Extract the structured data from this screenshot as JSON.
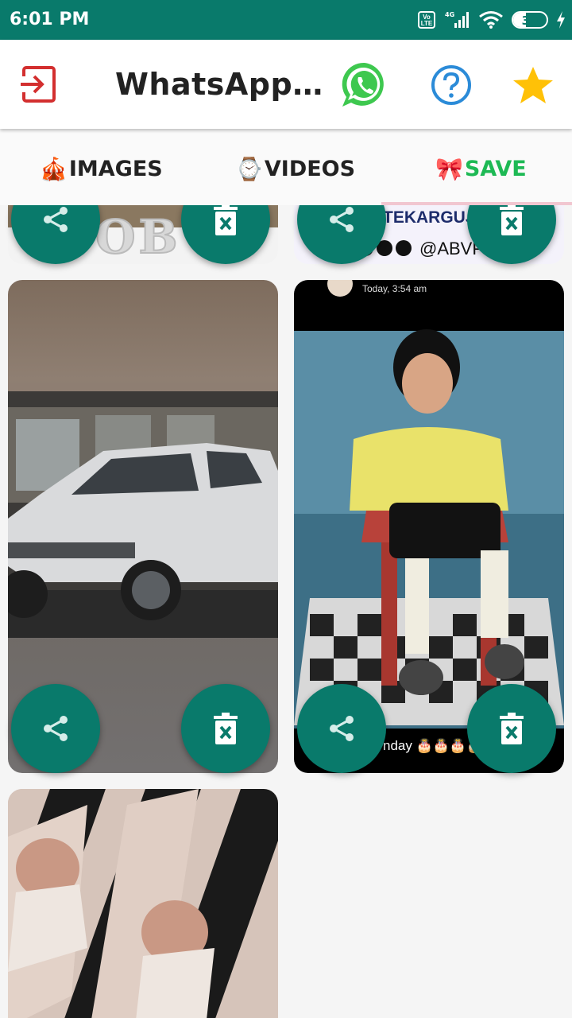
{
  "status_bar": {
    "time": "6:01 PM",
    "volte_label": "Vo LTE",
    "network": "4G",
    "battery": "39",
    "battery_fraction": 0.39
  },
  "app_bar": {
    "title": "WhatsApp…",
    "exit_icon": "exit-icon",
    "whatsapp_icon": "whatsapp-logo",
    "help_icon": "help-icon",
    "star_icon": "star-icon"
  },
  "tabs": [
    {
      "emoji": "🎪",
      "label": "IMAGES",
      "color": "#222222"
    },
    {
      "emoji": "⌚",
      "label": "VIDEOS",
      "color": "#222222"
    },
    {
      "emoji": "🎀",
      "label": "SAVE",
      "color": "#1db954"
    }
  ],
  "cards": {
    "top_right_text": "TEKARGUJA",
    "top_right_handle": "@ABVPG",
    "top_left_text": "OB",
    "story_time": "Today, 3:54 am",
    "story_caption": "nday 🎂🎂🎂🎂"
  },
  "colors": {
    "primary": "#097a6b",
    "accent_green": "#1db954",
    "exit_red": "#d32f2f",
    "help_blue": "#2b8bd8",
    "star_yellow": "#ffc107"
  }
}
